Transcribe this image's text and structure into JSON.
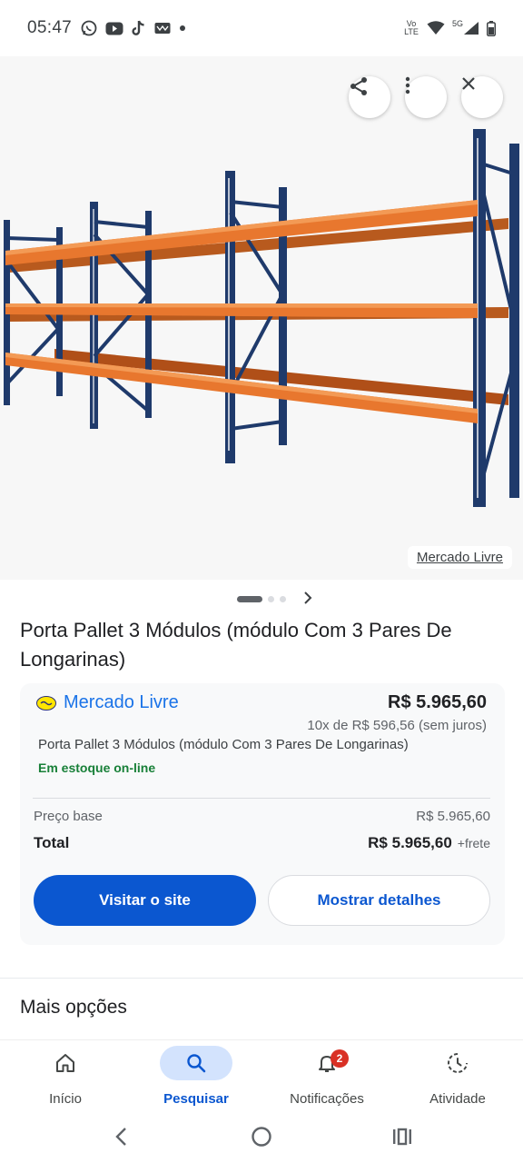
{
  "status_bar": {
    "time": "05:47",
    "left_icons": [
      "whatsapp-icon",
      "youtube-icon",
      "tiktok-icon",
      "app-icon",
      "dot-icon"
    ],
    "network_label": "Vo LTE",
    "signal_label": "5G"
  },
  "hero": {
    "source_label": "Mercado Livre",
    "actions": [
      "share-icon",
      "more-vert-icon",
      "close-icon"
    ],
    "colors": {
      "uprights": "#1f3a6b",
      "beams": "#e8772e",
      "background": "#f7f7f7"
    }
  },
  "carousel": {
    "total_images": 3,
    "current_index": 1
  },
  "product": {
    "title": "Porta Pallet 3 Módulos (módulo Com 3 Pares De Longarinas)"
  },
  "offer": {
    "seller": "Mercado Livre",
    "price": "R$ 5.965,60",
    "installments": "10x de R$ 596,56 (sem juros)",
    "description": "Porta Pallet 3 Módulos (módulo Com 3 Pares De Longarinas)",
    "stock": "Em estoque on-line",
    "base_price_label": "Preço base",
    "base_price_value": "R$ 5.965,60",
    "total_label": "Total",
    "total_value": "R$ 5.965,60",
    "shipping_note": "+frete",
    "visit_button": "Visitar o site",
    "details_button": "Mostrar detalhes"
  },
  "more_options": {
    "heading": "Mais opções"
  },
  "bottom_nav": {
    "items": [
      {
        "label": "Início",
        "icon": "home-icon",
        "active": false
      },
      {
        "label": "Pesquisar",
        "icon": "search-icon",
        "active": true
      },
      {
        "label": "Notificações",
        "icon": "bell-icon",
        "active": false,
        "badge": "2"
      },
      {
        "label": "Atividade",
        "icon": "activity-icon",
        "active": false
      }
    ]
  },
  "system_nav": [
    "back-icon",
    "home-circle-icon",
    "recents-icon"
  ],
  "colors": {
    "accent": "#0b57d0",
    "link": "#1a73e8",
    "in_stock": "#188038",
    "badge": "#d93025"
  }
}
